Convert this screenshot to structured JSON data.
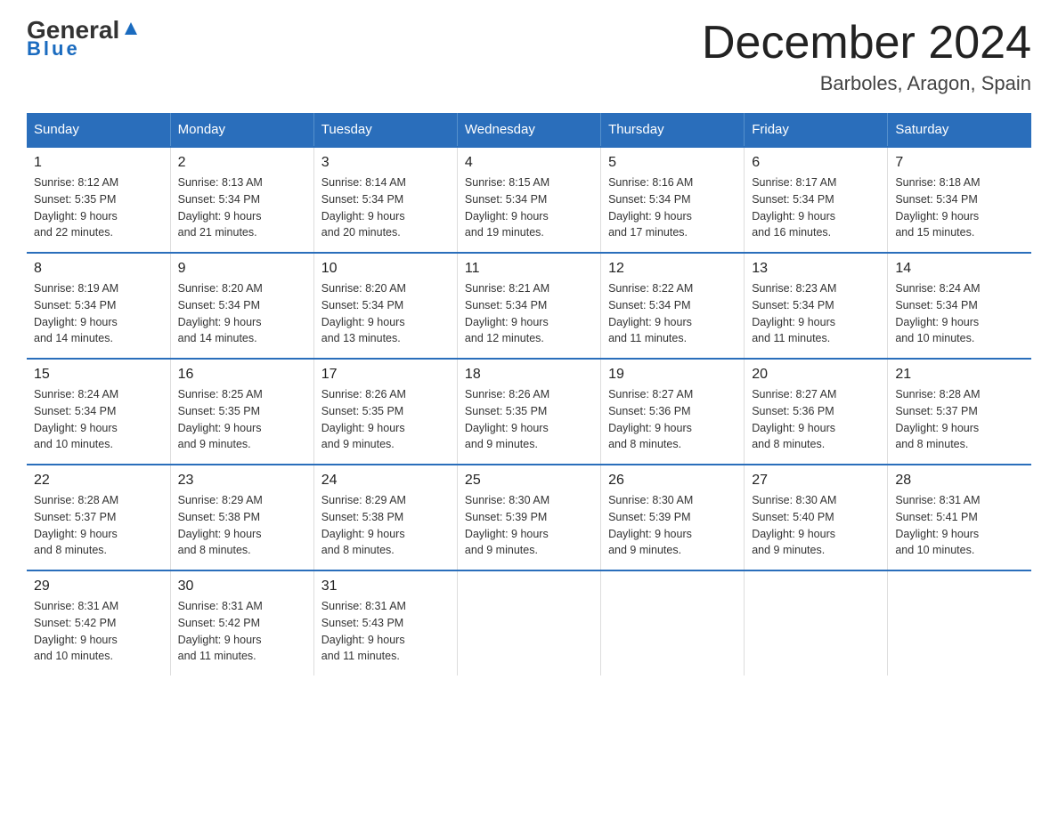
{
  "header": {
    "logo": {
      "general": "General",
      "blue": "Blue",
      "arrow": "▲"
    },
    "title": "December 2024",
    "location": "Barboles, Aragon, Spain"
  },
  "weekdays": [
    "Sunday",
    "Monday",
    "Tuesday",
    "Wednesday",
    "Thursday",
    "Friday",
    "Saturday"
  ],
  "weeks": [
    [
      {
        "day": "1",
        "sunrise": "8:12 AM",
        "sunset": "5:35 PM",
        "daylight": "9 hours and 22 minutes."
      },
      {
        "day": "2",
        "sunrise": "8:13 AM",
        "sunset": "5:34 PM",
        "daylight": "9 hours and 21 minutes."
      },
      {
        "day": "3",
        "sunrise": "8:14 AM",
        "sunset": "5:34 PM",
        "daylight": "9 hours and 20 minutes."
      },
      {
        "day": "4",
        "sunrise": "8:15 AM",
        "sunset": "5:34 PM",
        "daylight": "9 hours and 19 minutes."
      },
      {
        "day": "5",
        "sunrise": "8:16 AM",
        "sunset": "5:34 PM",
        "daylight": "9 hours and 17 minutes."
      },
      {
        "day": "6",
        "sunrise": "8:17 AM",
        "sunset": "5:34 PM",
        "daylight": "9 hours and 16 minutes."
      },
      {
        "day": "7",
        "sunrise": "8:18 AM",
        "sunset": "5:34 PM",
        "daylight": "9 hours and 15 minutes."
      }
    ],
    [
      {
        "day": "8",
        "sunrise": "8:19 AM",
        "sunset": "5:34 PM",
        "daylight": "9 hours and 14 minutes."
      },
      {
        "day": "9",
        "sunrise": "8:20 AM",
        "sunset": "5:34 PM",
        "daylight": "9 hours and 14 minutes."
      },
      {
        "day": "10",
        "sunrise": "8:20 AM",
        "sunset": "5:34 PM",
        "daylight": "9 hours and 13 minutes."
      },
      {
        "day": "11",
        "sunrise": "8:21 AM",
        "sunset": "5:34 PM",
        "daylight": "9 hours and 12 minutes."
      },
      {
        "day": "12",
        "sunrise": "8:22 AM",
        "sunset": "5:34 PM",
        "daylight": "9 hours and 11 minutes."
      },
      {
        "day": "13",
        "sunrise": "8:23 AM",
        "sunset": "5:34 PM",
        "daylight": "9 hours and 11 minutes."
      },
      {
        "day": "14",
        "sunrise": "8:24 AM",
        "sunset": "5:34 PM",
        "daylight": "9 hours and 10 minutes."
      }
    ],
    [
      {
        "day": "15",
        "sunrise": "8:24 AM",
        "sunset": "5:34 PM",
        "daylight": "9 hours and 10 minutes."
      },
      {
        "day": "16",
        "sunrise": "8:25 AM",
        "sunset": "5:35 PM",
        "daylight": "9 hours and 9 minutes."
      },
      {
        "day": "17",
        "sunrise": "8:26 AM",
        "sunset": "5:35 PM",
        "daylight": "9 hours and 9 minutes."
      },
      {
        "day": "18",
        "sunrise": "8:26 AM",
        "sunset": "5:35 PM",
        "daylight": "9 hours and 9 minutes."
      },
      {
        "day": "19",
        "sunrise": "8:27 AM",
        "sunset": "5:36 PM",
        "daylight": "9 hours and 8 minutes."
      },
      {
        "day": "20",
        "sunrise": "8:27 AM",
        "sunset": "5:36 PM",
        "daylight": "9 hours and 8 minutes."
      },
      {
        "day": "21",
        "sunrise": "8:28 AM",
        "sunset": "5:37 PM",
        "daylight": "9 hours and 8 minutes."
      }
    ],
    [
      {
        "day": "22",
        "sunrise": "8:28 AM",
        "sunset": "5:37 PM",
        "daylight": "9 hours and 8 minutes."
      },
      {
        "day": "23",
        "sunrise": "8:29 AM",
        "sunset": "5:38 PM",
        "daylight": "9 hours and 8 minutes."
      },
      {
        "day": "24",
        "sunrise": "8:29 AM",
        "sunset": "5:38 PM",
        "daylight": "9 hours and 8 minutes."
      },
      {
        "day": "25",
        "sunrise": "8:30 AM",
        "sunset": "5:39 PM",
        "daylight": "9 hours and 9 minutes."
      },
      {
        "day": "26",
        "sunrise": "8:30 AM",
        "sunset": "5:39 PM",
        "daylight": "9 hours and 9 minutes."
      },
      {
        "day": "27",
        "sunrise": "8:30 AM",
        "sunset": "5:40 PM",
        "daylight": "9 hours and 9 minutes."
      },
      {
        "day": "28",
        "sunrise": "8:31 AM",
        "sunset": "5:41 PM",
        "daylight": "9 hours and 10 minutes."
      }
    ],
    [
      {
        "day": "29",
        "sunrise": "8:31 AM",
        "sunset": "5:42 PM",
        "daylight": "9 hours and 10 minutes."
      },
      {
        "day": "30",
        "sunrise": "8:31 AM",
        "sunset": "5:42 PM",
        "daylight": "9 hours and 11 minutes."
      },
      {
        "day": "31",
        "sunrise": "8:31 AM",
        "sunset": "5:43 PM",
        "daylight": "9 hours and 11 minutes."
      },
      null,
      null,
      null,
      null
    ]
  ],
  "labels": {
    "sunrise": "Sunrise:",
    "sunset": "Sunset:",
    "daylight": "Daylight:"
  }
}
